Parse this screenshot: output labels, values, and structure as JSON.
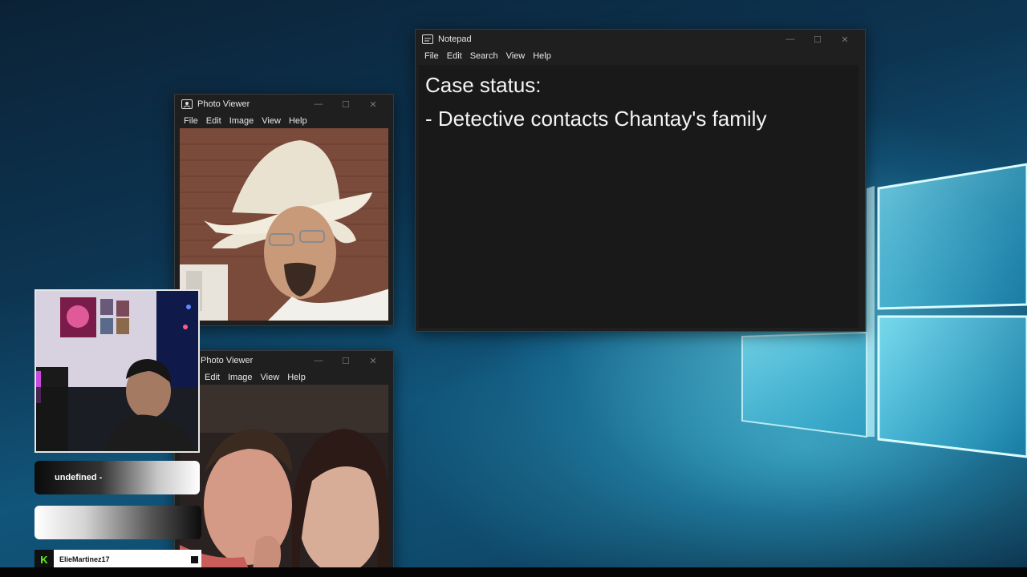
{
  "notepad": {
    "title": "Notepad",
    "menu": [
      "File",
      "Edit",
      "Search",
      "View",
      "Help"
    ],
    "lines": [
      "Case status:",
      "- Detective contacts Chantay's family"
    ]
  },
  "photo_viewer_1": {
    "title": "Photo Viewer",
    "menu": [
      "File",
      "Edit",
      "Image",
      "View",
      "Help"
    ]
  },
  "photo_viewer_2": {
    "title": "Photo Viewer",
    "menu": [
      "Edit",
      "Image",
      "View",
      "Help"
    ]
  },
  "window_controls": {
    "minimize": "—",
    "maximize": "☐",
    "close": "✕"
  },
  "overlay": {
    "label": "undefined -",
    "username": "ElieMartinez17",
    "kick_logo": "K"
  },
  "colors": {
    "window_bg": "#1f1f1f",
    "kick_green": "#53fc18"
  }
}
